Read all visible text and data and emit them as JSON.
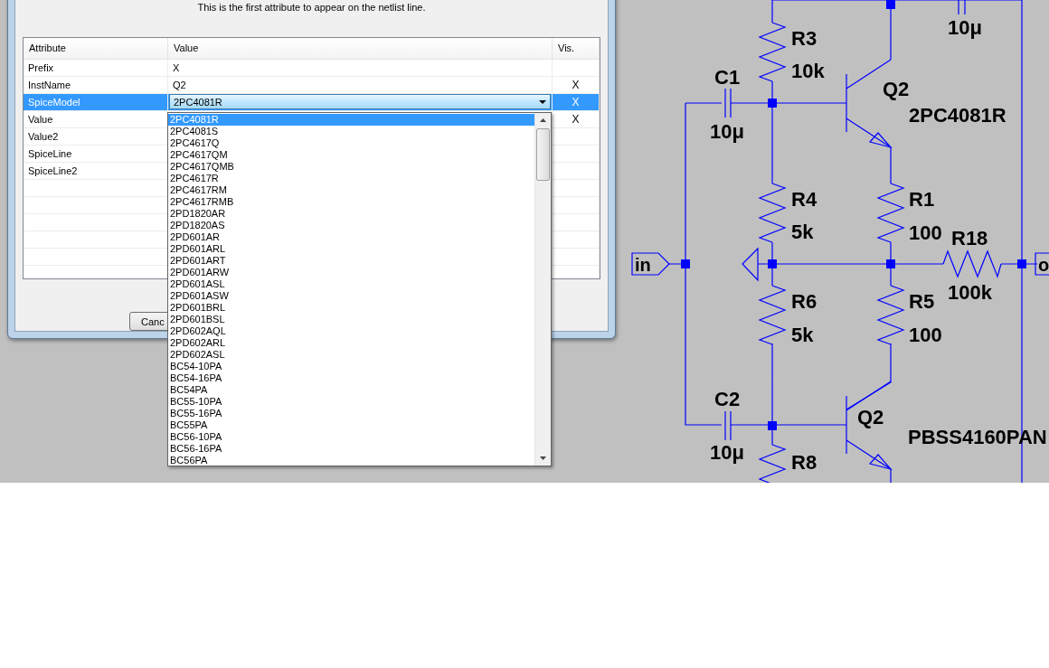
{
  "dialog": {
    "description": "This is the first attribute to appear on the netlist line.",
    "table": {
      "columns": [
        "Attribute",
        "Value",
        "Vis."
      ],
      "rows": [
        {
          "attribute": "Prefix",
          "value": "X",
          "selected": false
        },
        {
          "attribute": "InstName",
          "value": "Q2",
          "vis": "X",
          "selected": false
        },
        {
          "attribute": "SpiceModel",
          "value": "2PC4081R",
          "vis": "X",
          "selected": true,
          "kind": "combo"
        },
        {
          "attribute": "Value",
          "vis": "X",
          "selected": false
        },
        {
          "attribute": "Value2",
          "selected": false
        },
        {
          "attribute": "SpiceLine",
          "selected": false
        },
        {
          "attribute": "SpiceLine2",
          "selected": false
        }
      ]
    },
    "buttons": [
      "Canc"
    ]
  },
  "dropdown": {
    "options": [
      {
        "label": "2PC4081R",
        "selected": true
      },
      {
        "label": "2PC4081S",
        "selected": false
      },
      {
        "label": "2PC4617Q",
        "selected": false
      },
      {
        "label": "2PC4617QM",
        "selected": false
      },
      {
        "label": "2PC4617QMB",
        "selected": false
      },
      {
        "label": "2PC4617R",
        "selected": false
      },
      {
        "label": "2PC4617RM",
        "selected": false
      },
      {
        "label": "2PC4617RMB",
        "selected": false
      },
      {
        "label": "2PD1820AR",
        "selected": false
      },
      {
        "label": "2PD1820AS",
        "selected": false
      },
      {
        "label": "2PD601AR",
        "selected": false
      },
      {
        "label": "2PD601ARL",
        "selected": false
      },
      {
        "label": "2PD601ART",
        "selected": false
      },
      {
        "label": "2PD601ARW",
        "selected": false
      },
      {
        "label": "2PD601ASL",
        "selected": false
      },
      {
        "label": "2PD601ASW",
        "selected": false
      },
      {
        "label": "2PD601BRL",
        "selected": false
      },
      {
        "label": "2PD601BSL",
        "selected": false
      },
      {
        "label": "2PD602AQL",
        "selected": false
      },
      {
        "label": "2PD602ARL",
        "selected": false
      },
      {
        "label": "2PD602ASL",
        "selected": false
      },
      {
        "label": "BC54-10PA",
        "selected": false
      },
      {
        "label": "BC54-16PA",
        "selected": false
      },
      {
        "label": "BC54PA",
        "selected": false
      },
      {
        "label": "BC55-10PA",
        "selected": false
      },
      {
        "label": "BC55-16PA",
        "selected": false
      },
      {
        "label": "BC55PA",
        "selected": false
      },
      {
        "label": "BC56-10PA",
        "selected": false
      },
      {
        "label": "BC56-16PA",
        "selected": false
      },
      {
        "label": "BC56PA",
        "selected": false
      }
    ]
  },
  "schematic": {
    "resistors": [
      {
        "name": "R3",
        "value": "10k"
      },
      {
        "name": "R4",
        "value": "5k"
      },
      {
        "name": "R1",
        "value": "100"
      },
      {
        "name": "R18",
        "value": "100k"
      },
      {
        "name": "R6",
        "value": "5k"
      },
      {
        "name": "R5",
        "value": "100"
      },
      {
        "name": "R8"
      }
    ],
    "capacitors": [
      {
        "value": "10μ"
      },
      {
        "name": "C1",
        "value": "10μ"
      },
      {
        "name": "C2",
        "value": "10μ"
      }
    ],
    "transistors": [
      {
        "name": "Q2",
        "model": "2PC4081R"
      },
      {
        "name": "Q2",
        "model": "PBSS4160PAN"
      }
    ],
    "ports": [
      {
        "label": "in"
      },
      {
        "label": "o"
      }
    ]
  }
}
